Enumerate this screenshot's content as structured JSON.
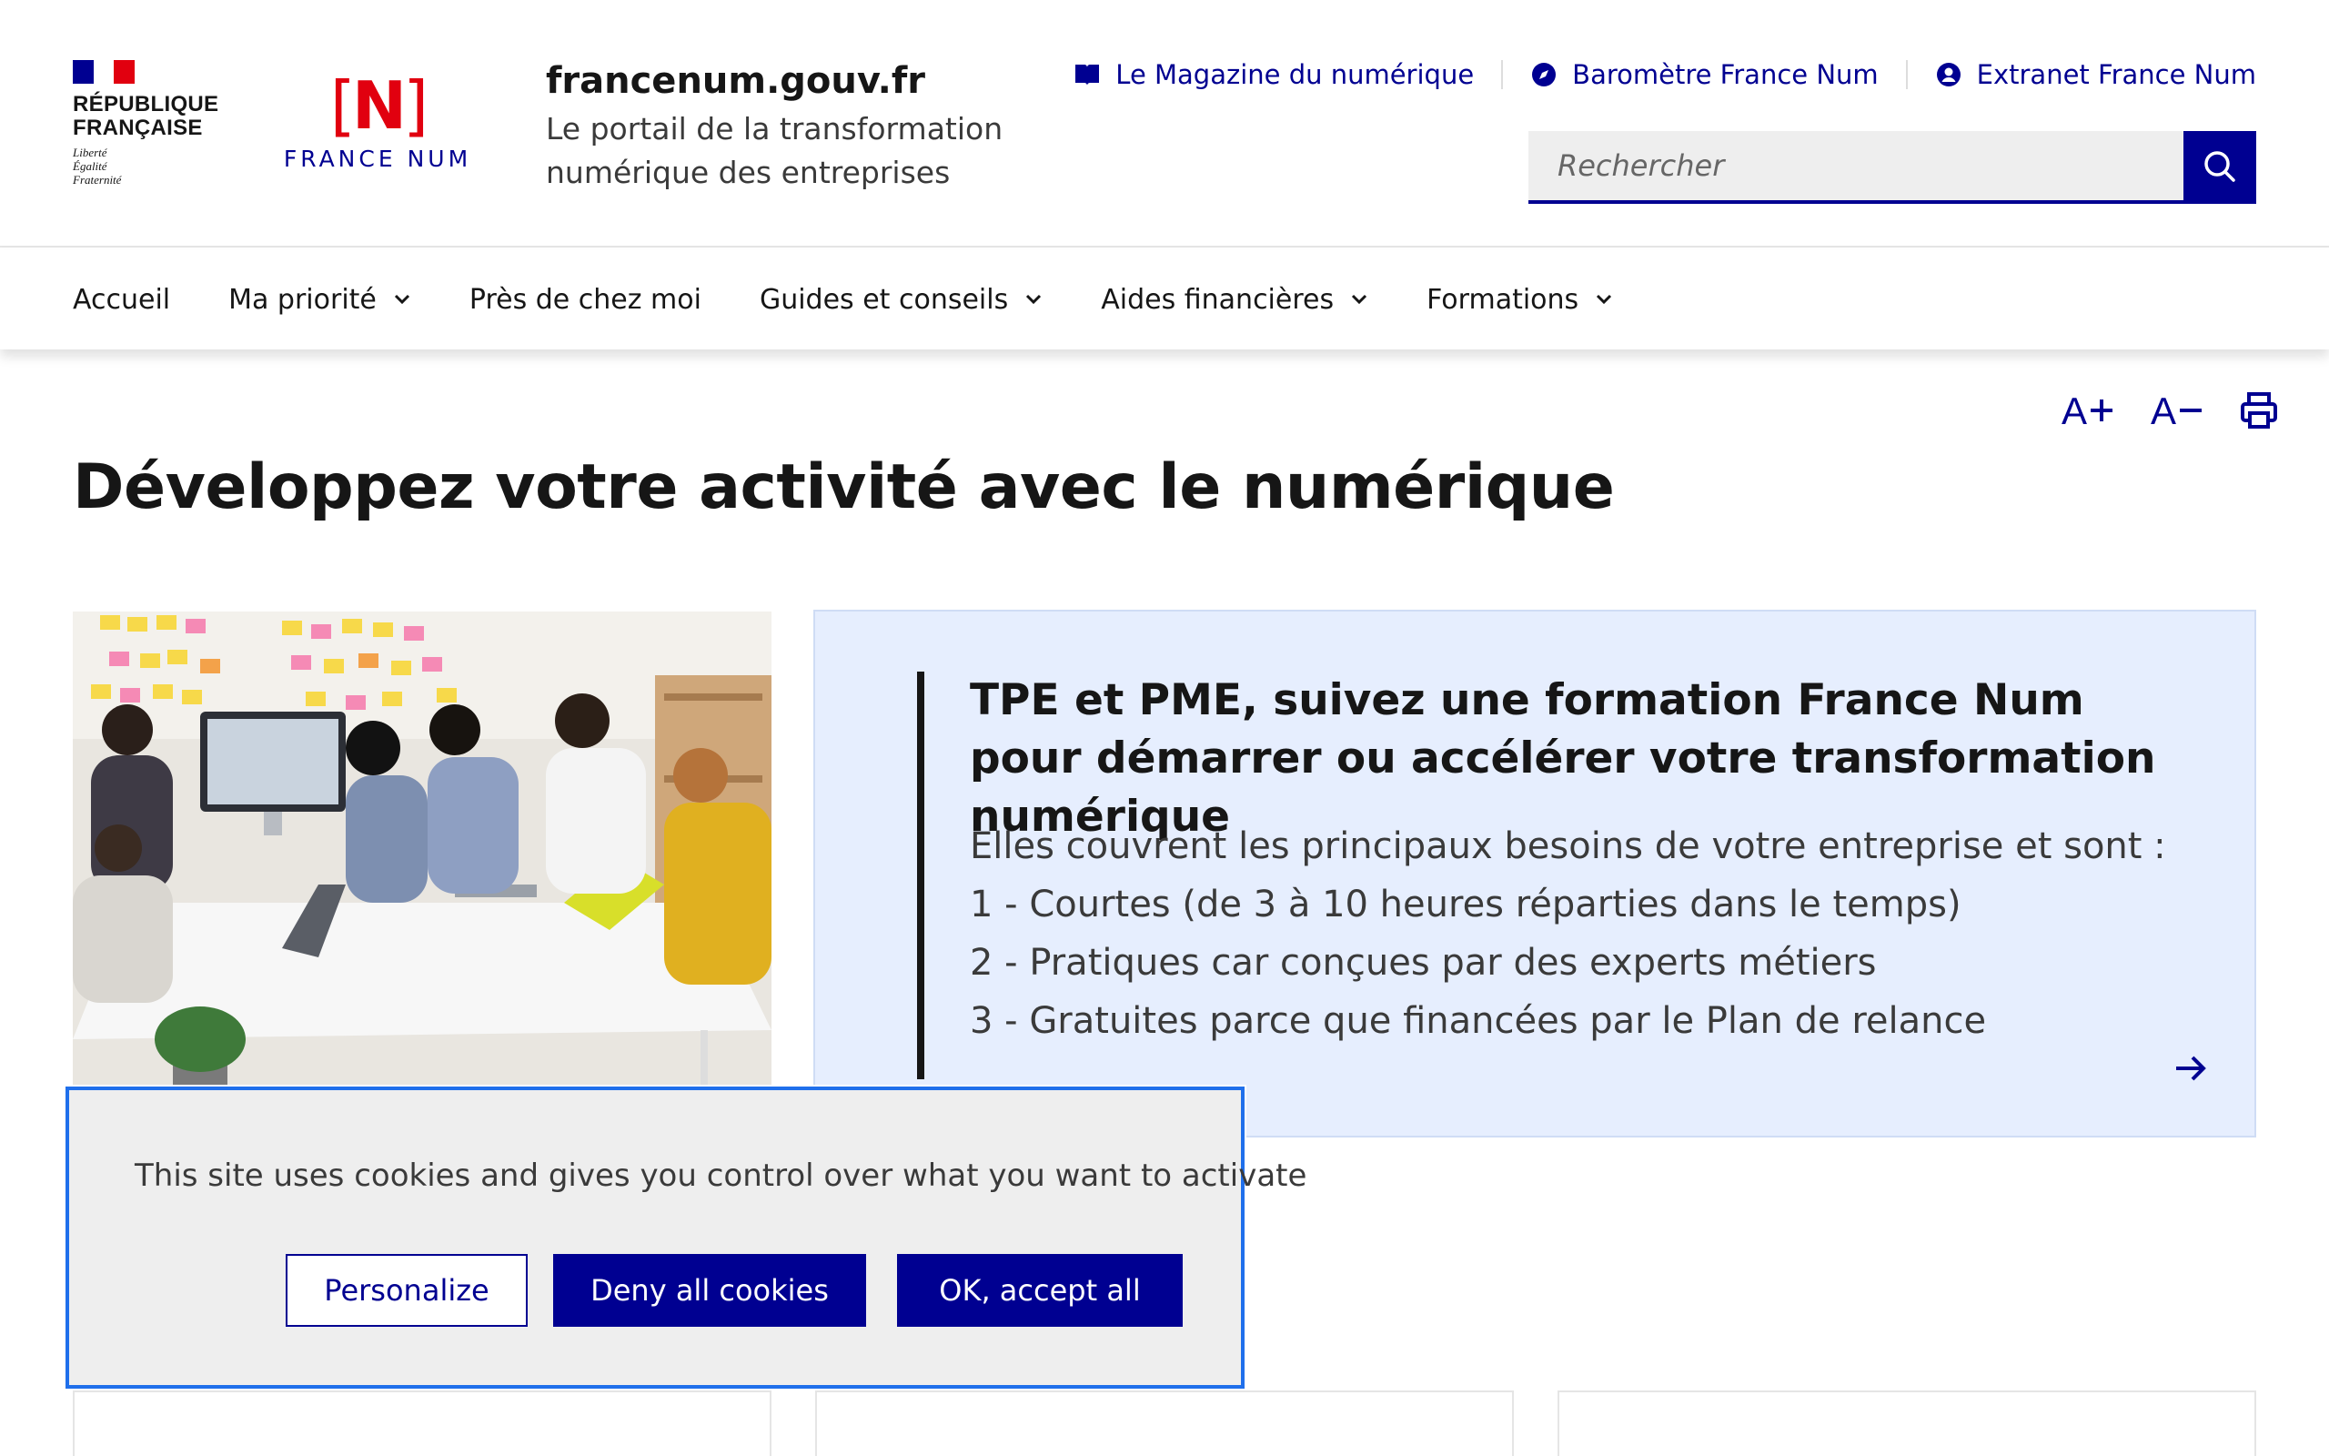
{
  "header": {
    "republique": {
      "name_line1": "RÉPUBLIQUE",
      "name_line2": "FRANÇAISE",
      "motto_line1": "Liberté",
      "motto_line2": "Égalité",
      "motto_line3": "Fraternité"
    },
    "brand": {
      "mark": "N",
      "name": "FRANCE NUM"
    },
    "site_title": "francenum.gouv.fr",
    "tagline": "Le portail de la transformation numérique des entreprises",
    "quick_links": [
      {
        "label": "Le Magazine du numérique",
        "icon": "book-icon"
      },
      {
        "label": "Baromètre France Num",
        "icon": "compass-icon"
      },
      {
        "label": "Extranet France Num",
        "icon": "user-circle-icon"
      }
    ],
    "search": {
      "placeholder": "Rechercher",
      "icon": "search-icon"
    }
  },
  "nav": {
    "items": [
      {
        "label": "Accueil",
        "has_dropdown": false
      },
      {
        "label": "Ma priorité",
        "has_dropdown": true
      },
      {
        "label": "Près de chez moi",
        "has_dropdown": false
      },
      {
        "label": "Guides et conseils",
        "has_dropdown": true
      },
      {
        "label": "Aides financières",
        "has_dropdown": true
      },
      {
        "label": "Formations",
        "has_dropdown": true
      }
    ]
  },
  "tools": {
    "increase_text": "A",
    "decrease_text": "A",
    "print_icon": "print-icon"
  },
  "main": {
    "page_title": "Développez votre activité avec le numérique",
    "hero": {
      "title": "TPE et PME, suivez une formation France Num pour démarrer ou accélérer votre transformation numérique",
      "intro": "Elles couvrent les principaux besoins de votre entreprise et sont :",
      "points": [
        "1 - Courtes (de 3 à 10 heures réparties dans le temps)",
        "2 - Pratiques car conçues par des experts métiers",
        "3 - Gratuites parce que financées par le Plan de relance"
      ]
    }
  },
  "cookie_banner": {
    "message": "This site uses cookies and gives you control over what you want to activate",
    "personalize_label": "Personalize",
    "deny_label": "Deny all cookies",
    "accept_label": "OK, accept all"
  },
  "colors": {
    "primary": "#000091",
    "marianne_red": "#e1000f",
    "hero_bg": "#e6eefe",
    "cookie_bg": "#eeeeee",
    "focus_outline": "#1f6feb"
  }
}
